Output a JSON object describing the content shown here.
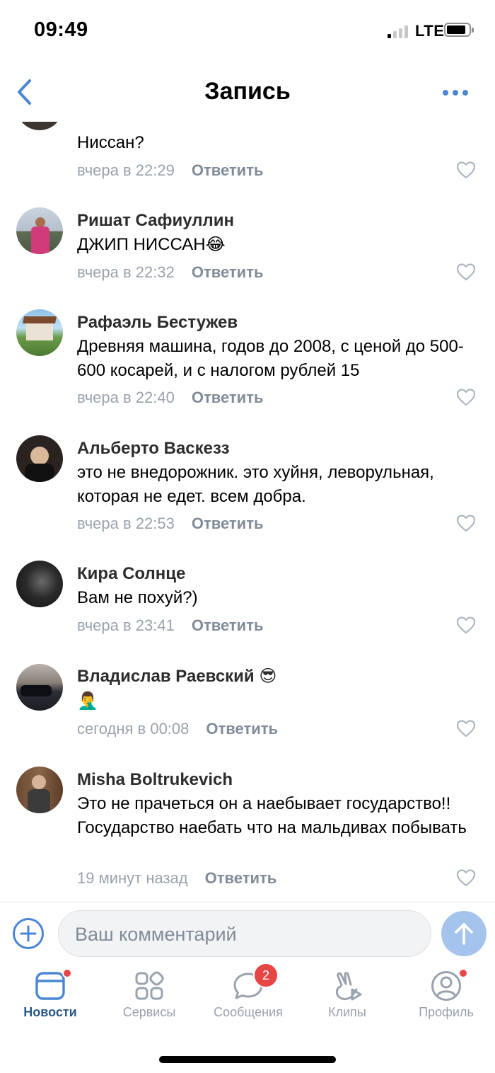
{
  "status_bar": {
    "time": "09:49",
    "network": "LTE"
  },
  "nav": {
    "title": "Запись",
    "back_icon": "chevron-left-icon",
    "more_icon": "more-dots-icon"
  },
  "comments": [
    {
      "author": "",
      "text": "Ниссан?",
      "time": "вчера в 22:29",
      "reply_label": "Ответить"
    },
    {
      "author": "Ришат Сафиуллин",
      "text": "ДЖИП НИССАН😂",
      "time": "вчера в 22:32",
      "reply_label": "Ответить"
    },
    {
      "author": "Рафаэль Бестужев",
      "text": "Древняя машина, годов до 2008, с ценой до 500-600 косарей, и с налогом рублей 15",
      "time": "вчера в 22:40",
      "reply_label": "Ответить"
    },
    {
      "author": "Альберто Васкезз",
      "text": "это не внедорожник. это хуйня, леворульная,  которая не едет. всем добра.",
      "time": "вчера в 22:53",
      "reply_label": "Ответить"
    },
    {
      "author": "Кира Солнце",
      "text": "Вам не похуй?)",
      "time": "вчера в 23:41",
      "reply_label": "Ответить"
    },
    {
      "author": "Владислав Раевский 😎",
      "text": "🤦‍♂️",
      "time": "сегодня в 00:08",
      "reply_label": "Ответить"
    },
    {
      "author": "Misha Boltrukevich",
      "text": "Это не прачеться он а наебывает государство!! Государство наебать что на мальдивах побывать",
      "time": "19 минут назад",
      "reply_label": "Ответить"
    }
  ],
  "composer": {
    "placeholder": "Ваш комментарий"
  },
  "tabs": [
    {
      "label": "Новости",
      "icon": "news-icon",
      "active": true,
      "dot": true
    },
    {
      "label": "Сервисы",
      "icon": "services-icon"
    },
    {
      "label": "Сообщения",
      "icon": "messages-icon",
      "badge": "2"
    },
    {
      "label": "Клипы",
      "icon": "clips-icon"
    },
    {
      "label": "Профиль",
      "icon": "profile-icon",
      "dot": true
    }
  ],
  "colors": {
    "accent": "#4a86d4",
    "secondary_text": "#99a2ad",
    "send_button": "#a4c4ee",
    "badge": "#e64646"
  }
}
